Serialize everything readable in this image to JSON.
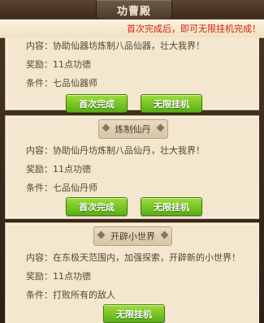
{
  "header": {
    "title": "功曹殿"
  },
  "notice": "首次完成后，即可无限挂机完成！",
  "labels": {
    "content": "内容：",
    "reward": "奖励：",
    "condition": "条件："
  },
  "tasks": [
    {
      "title": "",
      "content": "协助仙器坊炼制八品仙器，壮大我界！",
      "reward": "11点功德",
      "condition": "七品仙器师",
      "first_label": "首次完成",
      "idle_label": "无限挂机"
    },
    {
      "title": "炼制仙丹",
      "content": "协助仙丹坊炼制八品仙丹，壮大我界！",
      "reward": "11点功德",
      "condition": "七品仙丹师",
      "first_label": "首次完成",
      "idle_label": "无限挂机"
    },
    {
      "title": "开辟小世界",
      "content": "在东极天范围内，加强探索，开辟新的小世界！",
      "reward": "11点功德",
      "condition": "打败所有的敌人",
      "idle_label": "无限挂机"
    }
  ]
}
